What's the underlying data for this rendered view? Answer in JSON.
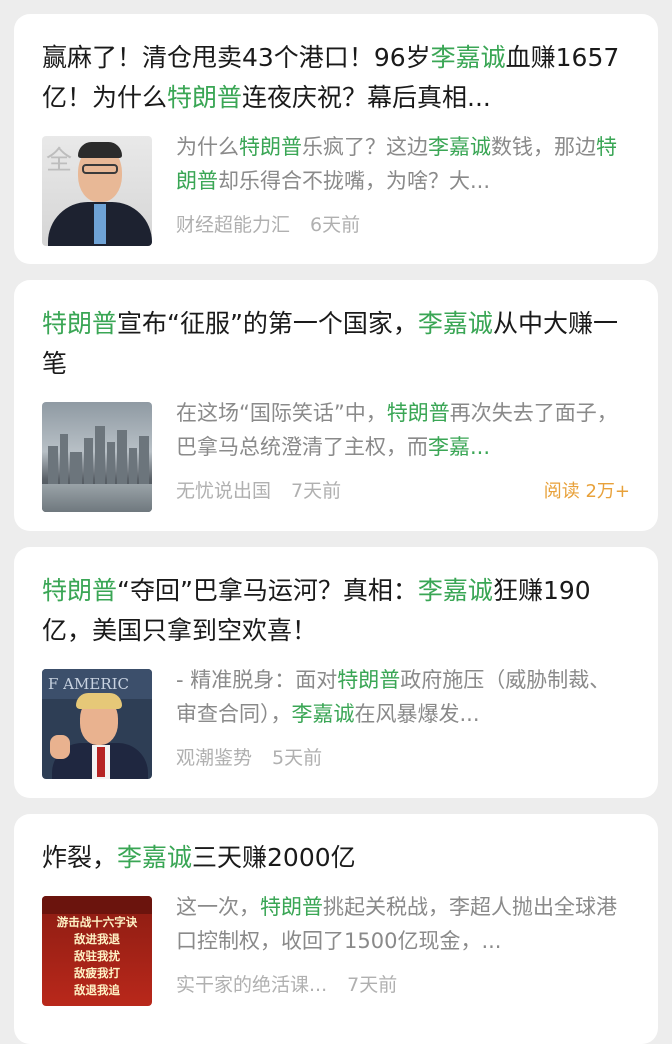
{
  "articles": [
    {
      "title": [
        {
          "text": "赢麻了！清仓甩卖43个港口！96岁",
          "hl": false
        },
        {
          "text": "李嘉诚",
          "hl": true
        },
        {
          "text": "血赚1657亿！为什么",
          "hl": false
        },
        {
          "text": "特朗普",
          "hl": true
        },
        {
          "text": "连夜庆祝？幕后真相...",
          "hl": false
        }
      ],
      "summary": [
        {
          "text": "为什么",
          "hl": false
        },
        {
          "text": "特朗普",
          "hl": true
        },
        {
          "text": "乐疯了？这边",
          "hl": false
        },
        {
          "text": "李嘉诚",
          "hl": true
        },
        {
          "text": "数钱，那边",
          "hl": false
        },
        {
          "text": "特朗普",
          "hl": true
        },
        {
          "text": "却乐得合不拢嘴，为啥？大...",
          "hl": false
        }
      ],
      "source": "财经超能力汇",
      "time": "6天前",
      "reads": "",
      "thumb_text": "全 業",
      "thumb_icon": "portrait-thumb"
    },
    {
      "title": [
        {
          "text": "特朗普",
          "hl": true
        },
        {
          "text": "宣布“征服”的第一个国家，",
          "hl": false
        },
        {
          "text": "李嘉诚",
          "hl": true
        },
        {
          "text": "从中大赚一笔",
          "hl": false
        }
      ],
      "summary": [
        {
          "text": "在这场“国际笑话”中，",
          "hl": false
        },
        {
          "text": "特朗普",
          "hl": true
        },
        {
          "text": "再次失去了面子，巴拿马总统澄清了主权，而",
          "hl": false
        },
        {
          "text": "李嘉...",
          "hl": true
        }
      ],
      "source": "无忧说出国",
      "time": "7天前",
      "reads": "阅读 2万+",
      "thumb_icon": "city-skyline-thumb"
    },
    {
      "title": [
        {
          "text": "特朗普",
          "hl": true
        },
        {
          "text": "“夺回”巴拿马运河？真相：",
          "hl": false
        },
        {
          "text": "李嘉诚",
          "hl": true
        },
        {
          "text": "狂赚190亿，美国只拿到空欢喜！",
          "hl": false
        }
      ],
      "summary": [
        {
          "text": "- 精准脱身：面对",
          "hl": false
        },
        {
          "text": "特朗普",
          "hl": true
        },
        {
          "text": "政府施压（威胁制裁、审查合同），",
          "hl": false
        },
        {
          "text": "李嘉诚",
          "hl": true
        },
        {
          "text": "在风暴爆发...",
          "hl": false
        }
      ],
      "source": "观潮鉴势",
      "time": "5天前",
      "reads": "",
      "thumb_text": "F AMERIC",
      "thumb_icon": "portrait-thumb"
    },
    {
      "title": [
        {
          "text": "炸裂，",
          "hl": false
        },
        {
          "text": "李嘉诚",
          "hl": true
        },
        {
          "text": "三天赚2000亿",
          "hl": false
        }
      ],
      "summary": [
        {
          "text": "这一次，",
          "hl": false
        },
        {
          "text": "特朗普",
          "hl": true
        },
        {
          "text": "挑起关税战，李超人抛出全球港口控制权，收回了1500亿现金，...",
          "hl": false
        }
      ],
      "source": "实干家的绝活课...",
      "time": "7天前",
      "reads": "",
      "thumb_text": [
        "游击战十六字诀",
        "敌进我退",
        "敌驻我扰",
        "敌疲我打",
        "敌退我追"
      ],
      "thumb_icon": "poster-thumb"
    }
  ],
  "colors": {
    "highlight": "#3aa655",
    "reads": "#e8a13a",
    "background": "#ededed"
  }
}
